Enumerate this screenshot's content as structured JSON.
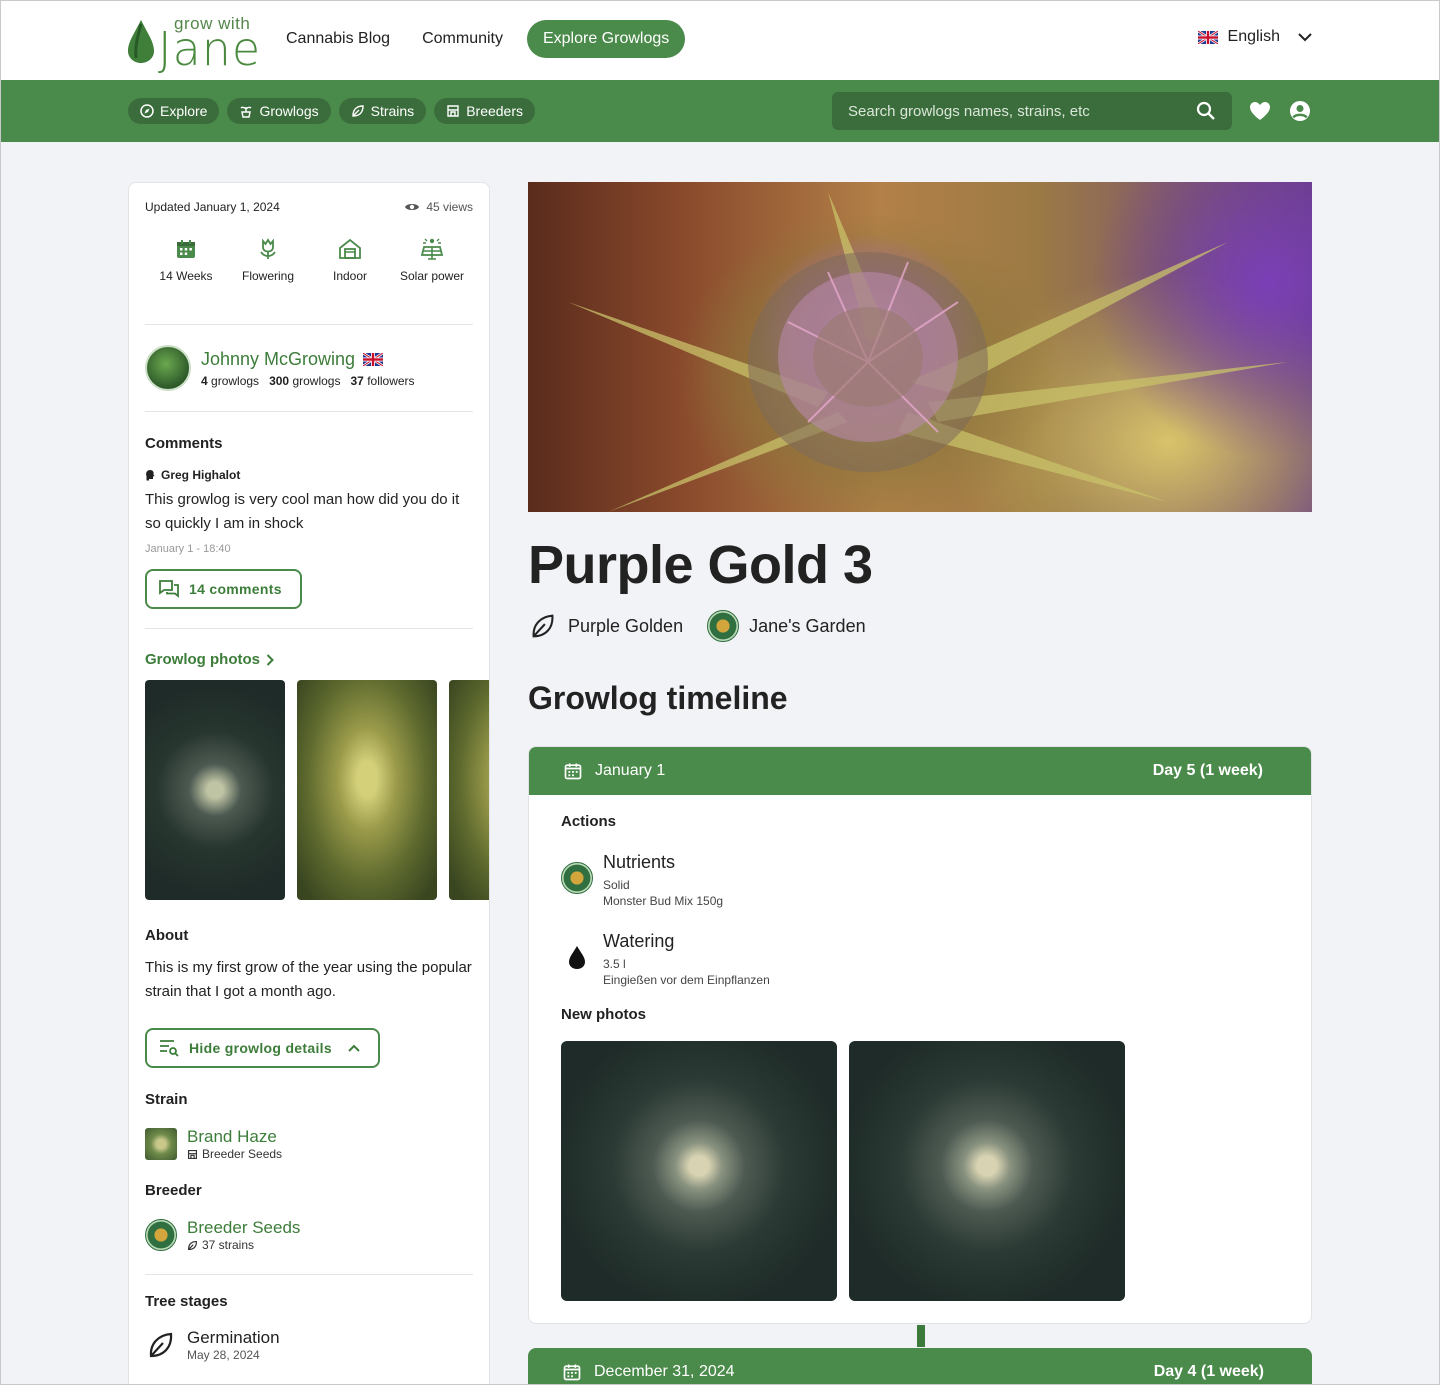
{
  "brand": {
    "tagline": "grow with",
    "name": "Jane"
  },
  "topnav": {
    "blog": "Cannabis Blog",
    "community": "Community",
    "explore_cta": "Explore Growlogs"
  },
  "language": {
    "label": "English"
  },
  "subnav": {
    "chips": [
      "Explore",
      "Growlogs",
      "Strains",
      "Breeders"
    ],
    "search_placeholder": "Search growlogs names, strains, etc"
  },
  "sidebar": {
    "updated": "Updated January 1, 2024",
    "views": "45 views",
    "stats": [
      {
        "label": "14 Weeks",
        "icon": "calendar-icon"
      },
      {
        "label": "Flowering",
        "icon": "flower-icon"
      },
      {
        "label": "Indoor",
        "icon": "greenhouse-icon"
      },
      {
        "label": "Solar power",
        "icon": "solar-panel-icon"
      }
    ],
    "author": {
      "name": "Johnny McGrowing",
      "growlogs_count": "4",
      "growlogs_label": "growlogs",
      "growlogs2_count": "300",
      "growlogs2_label": "growlogs",
      "followers_count": "37",
      "followers_label": "followers"
    },
    "comments": {
      "title": "Comments",
      "user": "Greg Highalot",
      "text": "This growlog is very cool man how did you do it so quickly I am in shock",
      "date": "January 1 - 18:40",
      "button": "14 comments"
    },
    "photos_title": "Growlog photos",
    "about": {
      "title": "About",
      "text": "This is my first grow of the year using the popular strain that I got a month ago."
    },
    "details_button": "Hide growlog details",
    "strain": {
      "title": "Strain",
      "name": "Brand Haze",
      "breeder": "Breeder Seeds"
    },
    "breeder": {
      "title": "Breeder",
      "name": "Breeder Seeds",
      "strains": "37 strains"
    },
    "tree_stages": {
      "title": "Tree stages",
      "stage": "Germination",
      "date": "May 28, 2024"
    }
  },
  "main": {
    "title": "Purple Gold 3",
    "tag_strain": "Purple Golden",
    "tag_garden": "Jane's Garden",
    "timeline_title": "Growlog timeline",
    "entries": [
      {
        "date": "January 1",
        "day": "Day 5 (1 week)",
        "actions_title": "Actions",
        "actions": [
          {
            "name": "Nutrients",
            "line1": "Solid",
            "line2": "Monster Bud Mix 150g"
          },
          {
            "name": "Watering",
            "line1": "3.5 l",
            "line2": "Eingießen vor dem Einpflanzen"
          }
        ],
        "photos_title": "New photos"
      },
      {
        "date": "December 31, 2024",
        "day": "Day 4 (1 week)"
      }
    ]
  },
  "colors": {
    "brand_green": "#4a8a4a",
    "dark_green": "#3b6d3c",
    "link_green": "#3d7d3a"
  }
}
